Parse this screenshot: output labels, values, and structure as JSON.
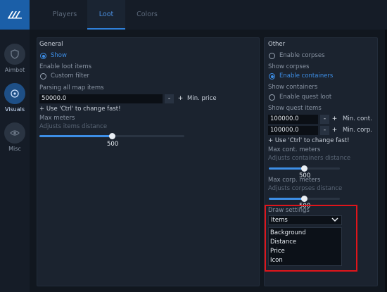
{
  "sidebar": {
    "items": [
      {
        "label": "Aimbot",
        "icon": "shield-icon",
        "active": false
      },
      {
        "label": "Visuals",
        "icon": "target-icon",
        "active": true
      },
      {
        "label": "Misc",
        "icon": "eye-icon",
        "active": false
      }
    ]
  },
  "tabs": [
    {
      "label": "Players",
      "active": false
    },
    {
      "label": "Loot",
      "active": true
    },
    {
      "label": "Colors",
      "active": false
    }
  ],
  "general": {
    "title": "General",
    "show_label": "Show",
    "enable_loot_label": "Enable loot items",
    "custom_filter_label": "Custom filter",
    "parsing_label": "Parsing all map items",
    "min_price_value": "50000.0",
    "min_price_label": "Min. price",
    "minus": "-",
    "plus": "+",
    "ctrl_hint": "+ Use 'Ctrl' to change fast!",
    "max_meters_label": "Max meters",
    "max_meters_hint": "Adjusts items distance",
    "max_meters_value": "500",
    "max_meters_fraction": 0.5
  },
  "other": {
    "title": "Other",
    "enable_corpses_label": "Enable corpses",
    "show_corpses_label": "Show corpses",
    "enable_containers_label": "Enable containers",
    "show_containers_label": "Show containers",
    "enable_quest_label": "Enable quest loot",
    "show_quest_label": "Show quest items",
    "min_cont_value": "100000.0",
    "min_cont_label": "Min. cont.",
    "min_corp_value": "100000.0",
    "min_corp_label": "Min. corp.",
    "minus": "-",
    "plus": "+",
    "ctrl_hint": "+ Use 'Ctrl' to change fast!",
    "max_cont_label": "Max cont. meters",
    "max_cont_hint": "Adjusts containers distance",
    "max_cont_value": "500",
    "max_cont_fraction": 0.5,
    "max_corp_label": "Max corp. meters",
    "max_corp_hint": "Adjusts corpses distance",
    "max_corp_value": "500",
    "max_corp_fraction": 0.5
  },
  "draw_settings": {
    "label": "Draw settings",
    "selected": "Items",
    "options": [
      "Background",
      "Distance",
      "Price",
      "Icon"
    ]
  },
  "colors": {
    "accent": "#3d8ee6",
    "highlight_box": "#e0151b"
  }
}
